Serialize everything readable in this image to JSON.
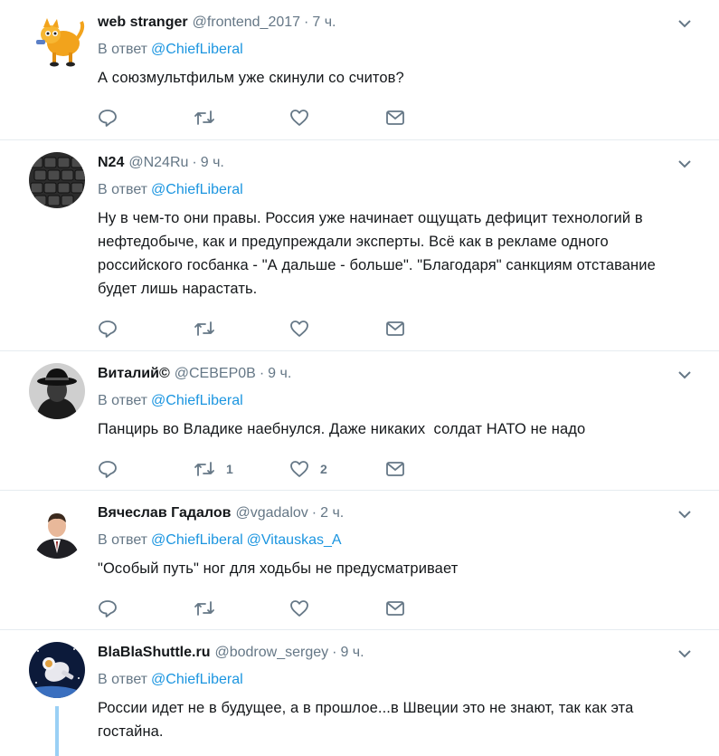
{
  "reply_prefix": "В ответ",
  "tweets": [
    {
      "name": "web stranger",
      "handle": "@frontend_2017",
      "dot": "·",
      "time": "7 ч.",
      "mentions": [
        "@ChiefLiberal"
      ],
      "text": "А союзмультфильм уже скинули со считов?",
      "retweets": "",
      "likes": "",
      "avatar": "cartoon-cat-avatar"
    },
    {
      "name": "N24",
      "handle": "@N24Ru",
      "dot": "·",
      "time": "9 ч.",
      "mentions": [
        "@ChiefLiberal"
      ],
      "text": "Ну в чем-то они правы. Россия уже начинает ощущать дефицит технологий в нефтедобыче, как и предупреждали эксперты. Всё как в рекламе одного российского госбанка - \"А дальше - больше\". \"Благодаря\" санкциям отставание будет лишь нарастать.",
      "retweets": "",
      "likes": "",
      "avatar": "keyboard-avatar"
    },
    {
      "name": "Виталий©",
      "handle": "@СЕВЕР0В",
      "dot": "·",
      "time": "9 ч.",
      "mentions": [
        "@ChiefLiberal"
      ],
      "text": "Панцирь во Владике наебнулся. Даже никаких  солдат НАТО не надо",
      "retweets": "1",
      "likes": "2",
      "avatar": "hat-man-avatar"
    },
    {
      "name": "Вячеслав Гадалов",
      "handle": "@vgadalov",
      "dot": "·",
      "time": "2 ч.",
      "mentions": [
        "@ChiefLiberal",
        "@Vitauskas_A"
      ],
      "text": "\"Особый путь\" ног для ходьбы не предусматривает",
      "retweets": "",
      "likes": "",
      "avatar": "portrait-avatar"
    },
    {
      "name": "BlaBlaShuttle.ru",
      "handle": "@bodrow_sergey",
      "dot": "·",
      "time": "9 ч.",
      "mentions": [
        "@ChiefLiberal"
      ],
      "text": "России идет не в будущее, а в прошлое...в Швеции это не знают, так как эта гостайна.",
      "retweets": "",
      "likes": "",
      "avatar": "astronaut-avatar"
    }
  ],
  "colors": {
    "link": "#1b95e0",
    "secondary": "#657786",
    "text": "#14171a",
    "divider": "#e6ecf0",
    "thread": "#9ad0f5"
  }
}
